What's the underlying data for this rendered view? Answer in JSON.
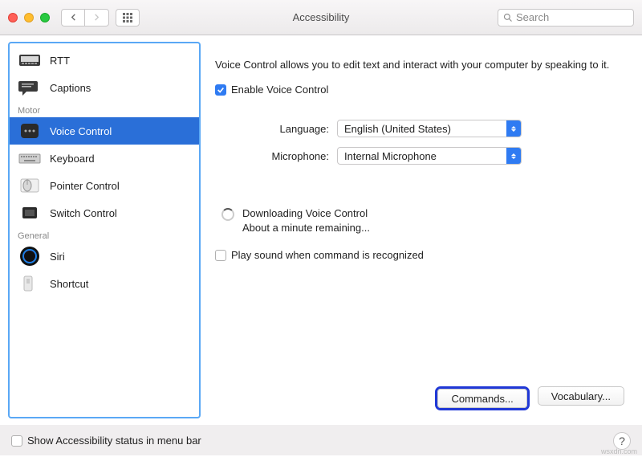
{
  "titlebar": {
    "title": "Accessibility",
    "search_placeholder": "Search"
  },
  "sidebar": {
    "items_top": [
      {
        "label": "RTT",
        "name": "sidebar-item-rtt"
      },
      {
        "label": "Captions",
        "name": "sidebar-item-captions"
      }
    ],
    "section_motor": "Motor",
    "items_motor": [
      {
        "label": "Voice Control",
        "name": "sidebar-item-voice-control",
        "selected": true
      },
      {
        "label": "Keyboard",
        "name": "sidebar-item-keyboard"
      },
      {
        "label": "Pointer Control",
        "name": "sidebar-item-pointer-control"
      },
      {
        "label": "Switch Control",
        "name": "sidebar-item-switch-control"
      }
    ],
    "section_general": "General",
    "items_general": [
      {
        "label": "Siri",
        "name": "sidebar-item-siri"
      },
      {
        "label": "Shortcut",
        "name": "sidebar-item-shortcut"
      }
    ]
  },
  "main": {
    "description": "Voice Control allows you to edit text and interact with your computer by speaking to it.",
    "enable_label": "Enable Voice Control",
    "enable_checked": true,
    "language_label": "Language:",
    "language_value": "English (United States)",
    "microphone_label": "Microphone:",
    "microphone_value": "Internal Microphone",
    "download_line1": "Downloading Voice Control",
    "download_line2": "About a minute remaining...",
    "playsound_label": "Play sound when command is recognized",
    "playsound_checked": false,
    "commands_btn": "Commands...",
    "vocabulary_btn": "Vocabulary..."
  },
  "bottom": {
    "status_label": "Show Accessibility status in menu bar",
    "status_checked": false,
    "help": "?"
  },
  "watermark": "wsxdn.com"
}
